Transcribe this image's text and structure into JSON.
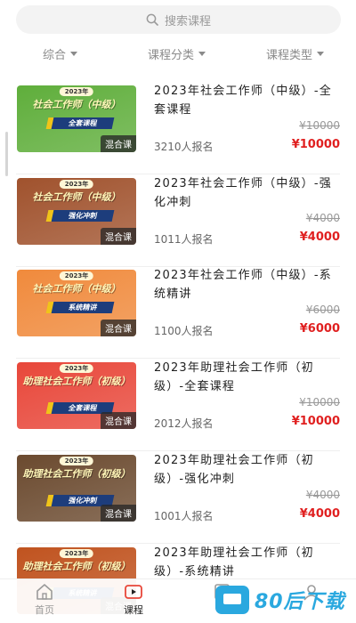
{
  "search": {
    "placeholder": "搜索课程"
  },
  "filters": [
    {
      "label": "综合"
    },
    {
      "label": "课程分类"
    },
    {
      "label": "课程类型"
    }
  ],
  "courses": [
    {
      "year": "2023年",
      "thumb_title": "社会工作师（中级）",
      "thumb_tag": "全套课程",
      "kind": "混合课",
      "title": "2023年社会工作师（中级）-全套课程",
      "orig": "¥10000",
      "price": "¥10000",
      "enrolled": "3210人报名",
      "color": "#5fae3b"
    },
    {
      "year": "2023年",
      "thumb_title": "社会工作师（中级）",
      "thumb_tag": "强化冲刺",
      "kind": "混合课",
      "title": "2023年社会工作师（中级）-强化冲刺",
      "orig": "¥4000",
      "price": "¥4000",
      "enrolled": "1011人报名",
      "color": "#a0522d"
    },
    {
      "year": "2023年",
      "thumb_title": "社会工作师（中级）",
      "thumb_tag": "系统精讲",
      "kind": "混合课",
      "title": "2023年社会工作师（中级）-系统精讲",
      "orig": "¥6000",
      "price": "¥6000",
      "enrolled": "1100人报名",
      "color": "#f08a3c"
    },
    {
      "year": "2023年",
      "thumb_title": "助理社会工作师（初级）",
      "thumb_tag": "全套课程",
      "kind": "混合课",
      "title": "2023年助理社会工作师（初级）-全套课程",
      "orig": "¥10000",
      "price": "¥10000",
      "enrolled": "2012人报名",
      "color": "#e8473a"
    },
    {
      "year": "2023年",
      "thumb_title": "助理社会工作师（初级）",
      "thumb_tag": "强化冲刺",
      "kind": "混合课",
      "title": "2023年助理社会工作师（初级）-强化冲刺",
      "orig": "¥4000",
      "price": "¥4000",
      "enrolled": "1001人报名",
      "color": "#6b4a2f"
    },
    {
      "year": "2023年",
      "thumb_title": "助理社会工作师（初级）",
      "thumb_tag": "系统精讲",
      "kind": "混合课",
      "title": "2023年助理社会工作师（初级）-系统精讲",
      "orig": "",
      "price": "",
      "enrolled": "",
      "color": "#c0531f"
    }
  ],
  "tabbar": [
    {
      "label": "首页",
      "icon": "home-icon"
    },
    {
      "label": "课程",
      "icon": "course-icon"
    },
    {
      "label": "",
      "icon": "note-icon"
    },
    {
      "label": "",
      "icon": "profile-icon"
    }
  ],
  "watermark": {
    "text": "80后下载"
  },
  "colors": {
    "price": "#e02020",
    "accent": "#e8473a"
  }
}
